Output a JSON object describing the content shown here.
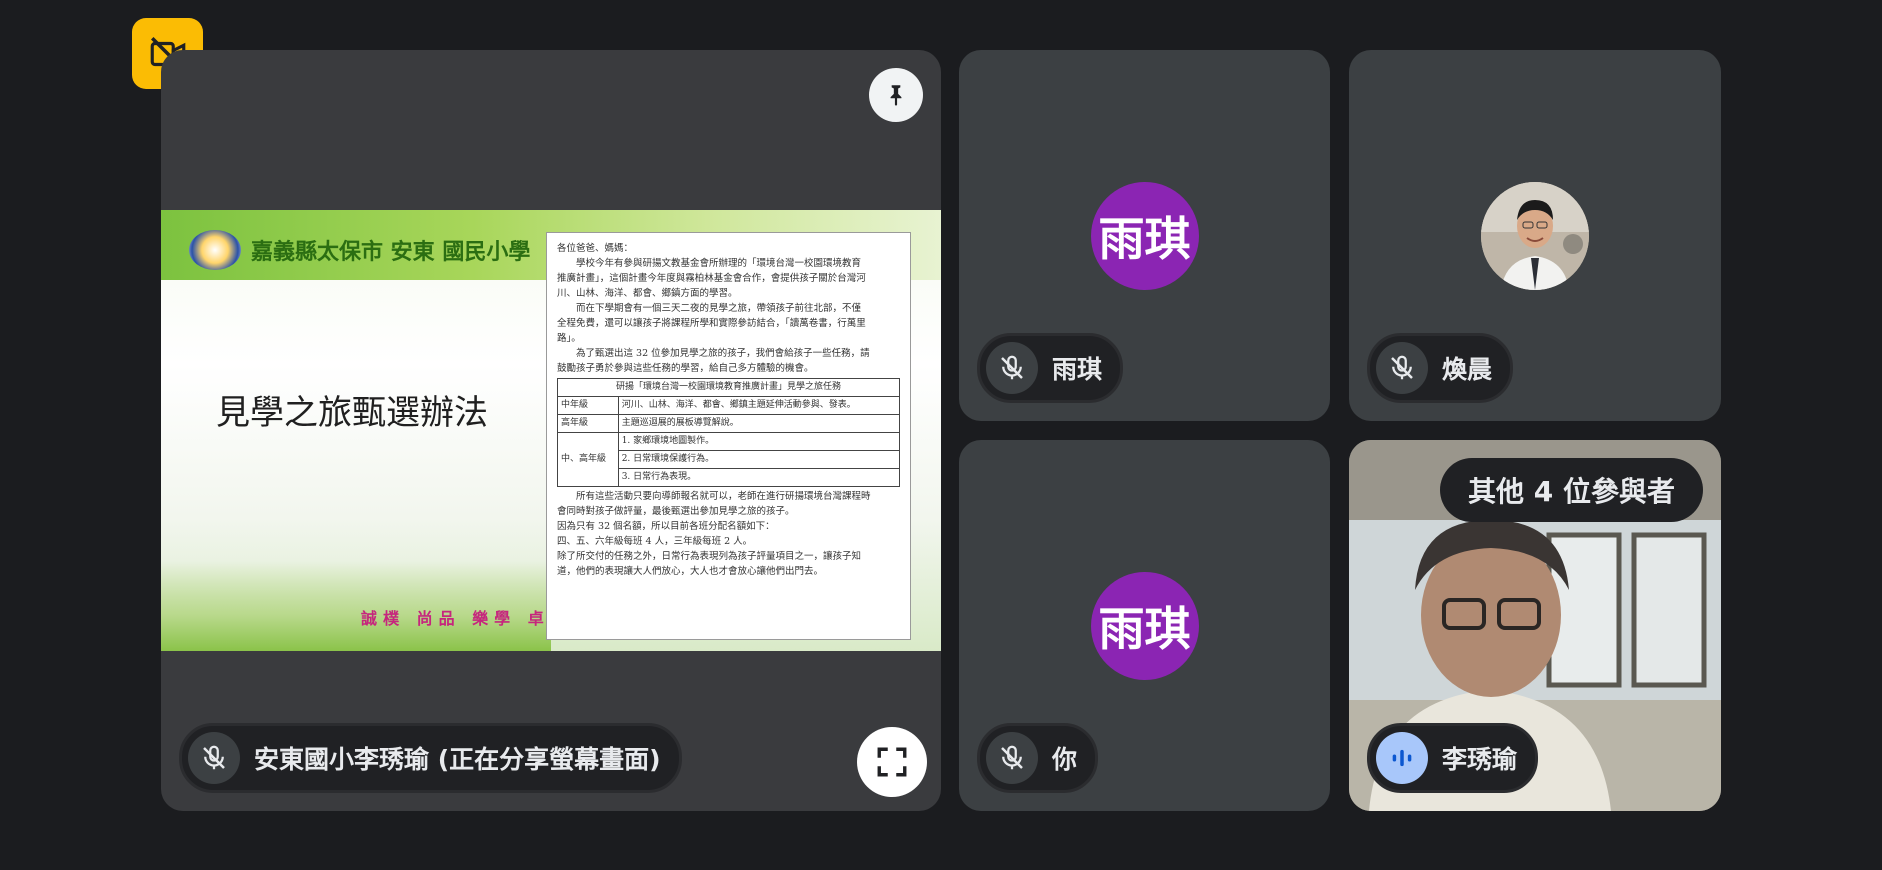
{
  "main_tile": {
    "presenter_name": "安東國小李琇瑜 (正在分享螢幕畫面)",
    "slide": {
      "school_name": "嘉義縣太保市 安東 國民小學",
      "title": "見學之旅甄選辦法",
      "values_text": "誠樸 尚品 樂學 卓越",
      "doc_lines": [
        "各位爸爸、媽媽：",
        "　　學校今年有參與研揚文教基金會所辦理的「環境台灣一校園環境教育",
        "推廣計畫」，這個計畫今年度與霧柏林基金會合作，會提供孩子關於台灣河",
        "川、山林、海洋、都會、鄉鎮方面的學習。",
        "　　而在下學期會有一個三天二夜的見學之旅，帶領孩子前往北部，不僅",
        "全程免費，還可以讓孩子將課程所學和實際參訪結合，「讀萬卷書，行萬里",
        "路」。",
        "　　為了甄選出這 32 位參加見學之旅的孩子，我們會給孩子一些任務，請",
        "鼓勵孩子勇於參與這些任務的學習，給自己多方體驗的機會。"
      ],
      "table": {
        "header": "研揚「環境台灣一校園環境教育推廣計畫」見學之旅任務",
        "rows": [
          {
            "grade": "中年級",
            "task": "河川、山林、海洋、都會、鄉鎮主題延伸活動參與、發表。"
          },
          {
            "grade": "高年級",
            "task": "主題巡迴展的展板導覽解說。"
          },
          {
            "grade": "中、高年級",
            "task": "1. 家鄉環境地圖製作。"
          },
          {
            "grade": "",
            "task": "2. 日常環境保護行為。"
          },
          {
            "grade": "",
            "task": "3. 日常行為表現。"
          }
        ]
      },
      "doc_lines_after": [
        "　　所有這些活動只要向導師報名就可以，老師在進行研揚環境台灣課程時",
        "會同時對孩子做評量，最後甄選出參加見學之旅的孩子。",
        "因為只有 32 個名額，所以目前各班分配名額如下：",
        "四、五、六年級每班 4 人，三年級每班 2 人。",
        "除了所交付的任務之外，日常行為表現列為孩子評量項目之一，讓孩子知",
        "道，他們的表現讓大人們放心，大人也才會放心讓他們出門去。"
      ]
    }
  },
  "participants": [
    {
      "id": "yq1",
      "name": "雨琪",
      "avatar_letter": "雨琪",
      "avatar_color": "#8b25b3",
      "muted": true
    },
    {
      "id": "hc",
      "name": "煥晨",
      "avatar": "photo",
      "muted": true
    },
    {
      "id": "you",
      "name": "你",
      "avatar_letter": "雨琪",
      "avatar_color": "#8b25b3",
      "muted": true
    },
    {
      "id": "lxy",
      "name": "李琇瑜",
      "speaking": true
    }
  ],
  "others_pill": "其他 4 位參與者",
  "icons": {
    "camera_off_badge": "camera-off-icon",
    "pin": "pin-icon",
    "fullscreen": "fullscreen-icon",
    "mic_off": "mic-off-icon",
    "speaking": "audio-level-icon"
  },
  "colors": {
    "background": "#1b1c1f",
    "tile": "#3c4043",
    "avatar_purple": "#8b25b3",
    "badge_yellow": "#fbbc04",
    "speaking_blue": "#a8c7fa"
  }
}
